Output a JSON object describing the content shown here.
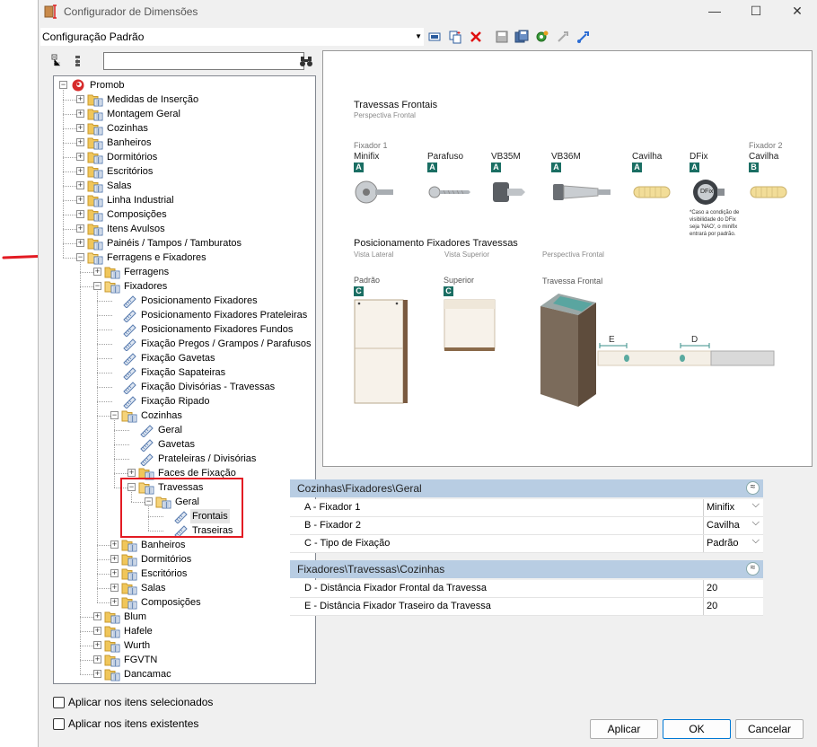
{
  "window": {
    "title": "Configurador de Dimensões",
    "minimize_glyph": "—",
    "maximize_glyph": "☐",
    "close_glyph": "✕"
  },
  "config": {
    "selected": "Configuração Padrão"
  },
  "toolbar_icons": [
    "select-icon",
    "copy-icon",
    "delete-icon",
    "save-icon",
    "save-as-icon",
    "settings-icon",
    "import-icon",
    "export-icon"
  ],
  "tree": {
    "search_value": "",
    "nodes": [
      {
        "label": "Promob",
        "level": 0,
        "type": "root"
      },
      {
        "label": "Medidas de Inserção",
        "level": 1,
        "type": "folder"
      },
      {
        "label": "Montagem Geral",
        "level": 1,
        "type": "folder"
      },
      {
        "label": "Cozinhas",
        "level": 1,
        "type": "folder"
      },
      {
        "label": "Banheiros",
        "level": 1,
        "type": "folder"
      },
      {
        "label": "Dormitórios",
        "level": 1,
        "type": "folder"
      },
      {
        "label": "Escritórios",
        "level": 1,
        "type": "folder"
      },
      {
        "label": "Salas",
        "level": 1,
        "type": "folder"
      },
      {
        "label": "Linha Industrial",
        "level": 1,
        "type": "folder"
      },
      {
        "label": "Composições",
        "level": 1,
        "type": "folder"
      },
      {
        "label": "Itens Avulsos",
        "level": 1,
        "type": "folder"
      },
      {
        "label": "Painéis / Tampos / Tamburatos",
        "level": 1,
        "type": "folder"
      },
      {
        "label": "Ferragens e Fixadores",
        "level": 1,
        "type": "folder-open"
      },
      {
        "label": "Ferragens",
        "level": 2,
        "type": "folder"
      },
      {
        "label": "Fixadores",
        "level": 2,
        "type": "folder-open"
      },
      {
        "label": "Posicionamento Fixadores",
        "level": 3,
        "type": "item"
      },
      {
        "label": "Posicionamento Fixadores Prateleiras",
        "level": 3,
        "type": "item"
      },
      {
        "label": "Posicionamento Fixadores Fundos",
        "level": 3,
        "type": "item"
      },
      {
        "label": "Fixação Pregos / Grampos / Parafusos",
        "level": 3,
        "type": "item"
      },
      {
        "label": "Fixação Gavetas",
        "level": 3,
        "type": "item"
      },
      {
        "label": "Fixação Sapateiras",
        "level": 3,
        "type": "item"
      },
      {
        "label": "Fixação Divisórias - Travessas",
        "level": 3,
        "type": "item"
      },
      {
        "label": "Fixação Ripado",
        "level": 3,
        "type": "item"
      },
      {
        "label": "Cozinhas",
        "level": 3,
        "type": "folder-open"
      },
      {
        "label": "Geral",
        "level": 4,
        "type": "item"
      },
      {
        "label": "Gavetas",
        "level": 4,
        "type": "item"
      },
      {
        "label": "Prateleiras / Divisórias",
        "level": 4,
        "type": "item"
      },
      {
        "label": "Faces de Fixação",
        "level": 4,
        "type": "folder"
      },
      {
        "label": "Travessas",
        "level": 4,
        "type": "folder-open"
      },
      {
        "label": "Geral",
        "level": 5,
        "type": "folder-open"
      },
      {
        "label": "Frontais",
        "level": 6,
        "type": "item",
        "selected": true
      },
      {
        "label": "Traseiras",
        "level": 6,
        "type": "item"
      },
      {
        "label": "Banheiros",
        "level": 3,
        "type": "folder"
      },
      {
        "label": "Dormitórios",
        "level": 3,
        "type": "folder"
      },
      {
        "label": "Escritórios",
        "level": 3,
        "type": "folder"
      },
      {
        "label": "Salas",
        "level": 3,
        "type": "folder"
      },
      {
        "label": "Composições",
        "level": 3,
        "type": "folder"
      },
      {
        "label": "Blum",
        "level": 2,
        "type": "folder"
      },
      {
        "label": "Hafele",
        "level": 2,
        "type": "folder"
      },
      {
        "label": "Wurth",
        "level": 2,
        "type": "folder"
      },
      {
        "label": "FGVTN",
        "level": 2,
        "type": "folder"
      },
      {
        "label": "Dancamac",
        "level": 2,
        "type": "folder"
      }
    ]
  },
  "checkboxes": {
    "selected_items": {
      "label": "Aplicar nos itens selecionados",
      "checked": false
    },
    "existing_items": {
      "label": "Aplicar nos itens existentes",
      "checked": false
    }
  },
  "preview": {
    "title": "Travessas Frontais",
    "subtitle": "Perspectiva Frontal",
    "fixers": [
      {
        "top": "Fixador 1",
        "name": "Minifix",
        "badge": "A"
      },
      {
        "top": "",
        "name": "Parafuso",
        "badge": "A"
      },
      {
        "top": "",
        "name": "VB35M",
        "badge": "A"
      },
      {
        "top": "",
        "name": "VB36M",
        "badge": "A"
      },
      {
        "top": "",
        "name": "Cavilha",
        "badge": "A"
      },
      {
        "top": "",
        "name": "DFix",
        "badge": "A"
      },
      {
        "top": "Fixador 2",
        "name": "Cavilha",
        "badge": "B"
      }
    ],
    "dfix_label": "DFix",
    "dfix_note": [
      "*Caso a condição de",
      "visibilidade do DFix",
      "seja 'NAO', o minifix",
      "entrará  por padrão."
    ],
    "section2_title": "Posicionamento Fixadores Travessas",
    "views": {
      "lateral": "Vista Lateral",
      "superior": "Vista Superior",
      "frontal": "Perspectiva Frontal"
    },
    "labels": {
      "padrao": "Padrão",
      "superior": "Superior",
      "travessa": "Travessa Frontal",
      "badge_c": "C",
      "dim_e": "E",
      "dim_d": "D"
    }
  },
  "properties": {
    "groups": [
      {
        "header": "Cozinhas\\Fixadores\\Geral",
        "rows": [
          {
            "name": "A - Fixador 1",
            "value": "Minifix",
            "combo": true
          },
          {
            "name": "B - Fixador 2",
            "value": "Cavilha",
            "combo": true
          },
          {
            "name": "C - Tipo de Fixação",
            "value": "Padrão",
            "combo": true
          }
        ]
      },
      {
        "header": "Fixadores\\Travessas\\Cozinhas",
        "rows": [
          {
            "name": "D - Distância Fixador Frontal da Travessa",
            "value": "20",
            "combo": false
          },
          {
            "name": "E - Distância Fixador Traseiro da Travessa",
            "value": "20",
            "combo": false
          }
        ]
      }
    ],
    "collapse_glyph": "≈"
  },
  "buttons": {
    "apply": "Aplicar",
    "ok": "OK",
    "cancel": "Cancelar"
  },
  "colors": {
    "accent_badge": "#1a6e63",
    "annotation_red": "#e31b23",
    "group_header": "#b8cde3"
  }
}
